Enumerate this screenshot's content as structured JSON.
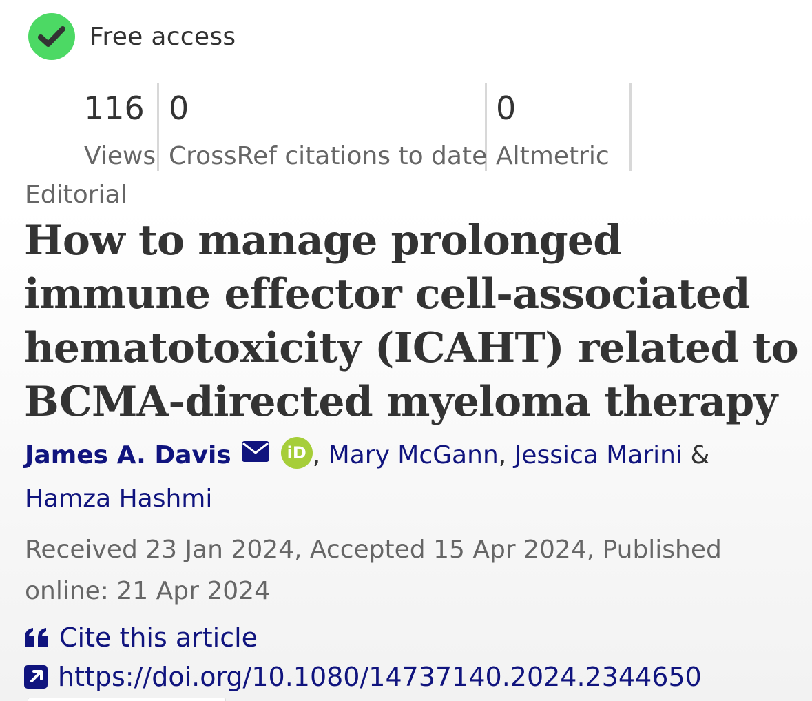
{
  "access": {
    "label": "Free access",
    "icon": "check-circle-icon",
    "color": "#4cd964"
  },
  "metrics": [
    {
      "value": "116",
      "label": "Views"
    },
    {
      "value": "0",
      "label": "CrossRef citations to date"
    },
    {
      "value": "0",
      "label": "Altmetric"
    }
  ],
  "article": {
    "type": "Editorial",
    "title": "How to manage prolonged immune effector cell-associated hematotoxicity (ICAHT) related to BCMA-directed myeloma therapy",
    "authors": [
      "James A. Davis",
      "Mary McGann",
      "Jessica Marini",
      "Hamza Hashmi"
    ],
    "author_separators": [
      ",",
      ",",
      "&"
    ],
    "orcid_icon_text": "iD",
    "dates": "Received 23 Jan 2024, Accepted 15 Apr 2024, Published online: 21 Apr 2024",
    "cite_label": "Cite this article",
    "doi": "https://doi.org/10.1080/14737140.2024.2344650"
  },
  "colors": {
    "link": "#10147e",
    "orcid": "#a6ce39",
    "text": "#333333",
    "muted": "#666666"
  }
}
